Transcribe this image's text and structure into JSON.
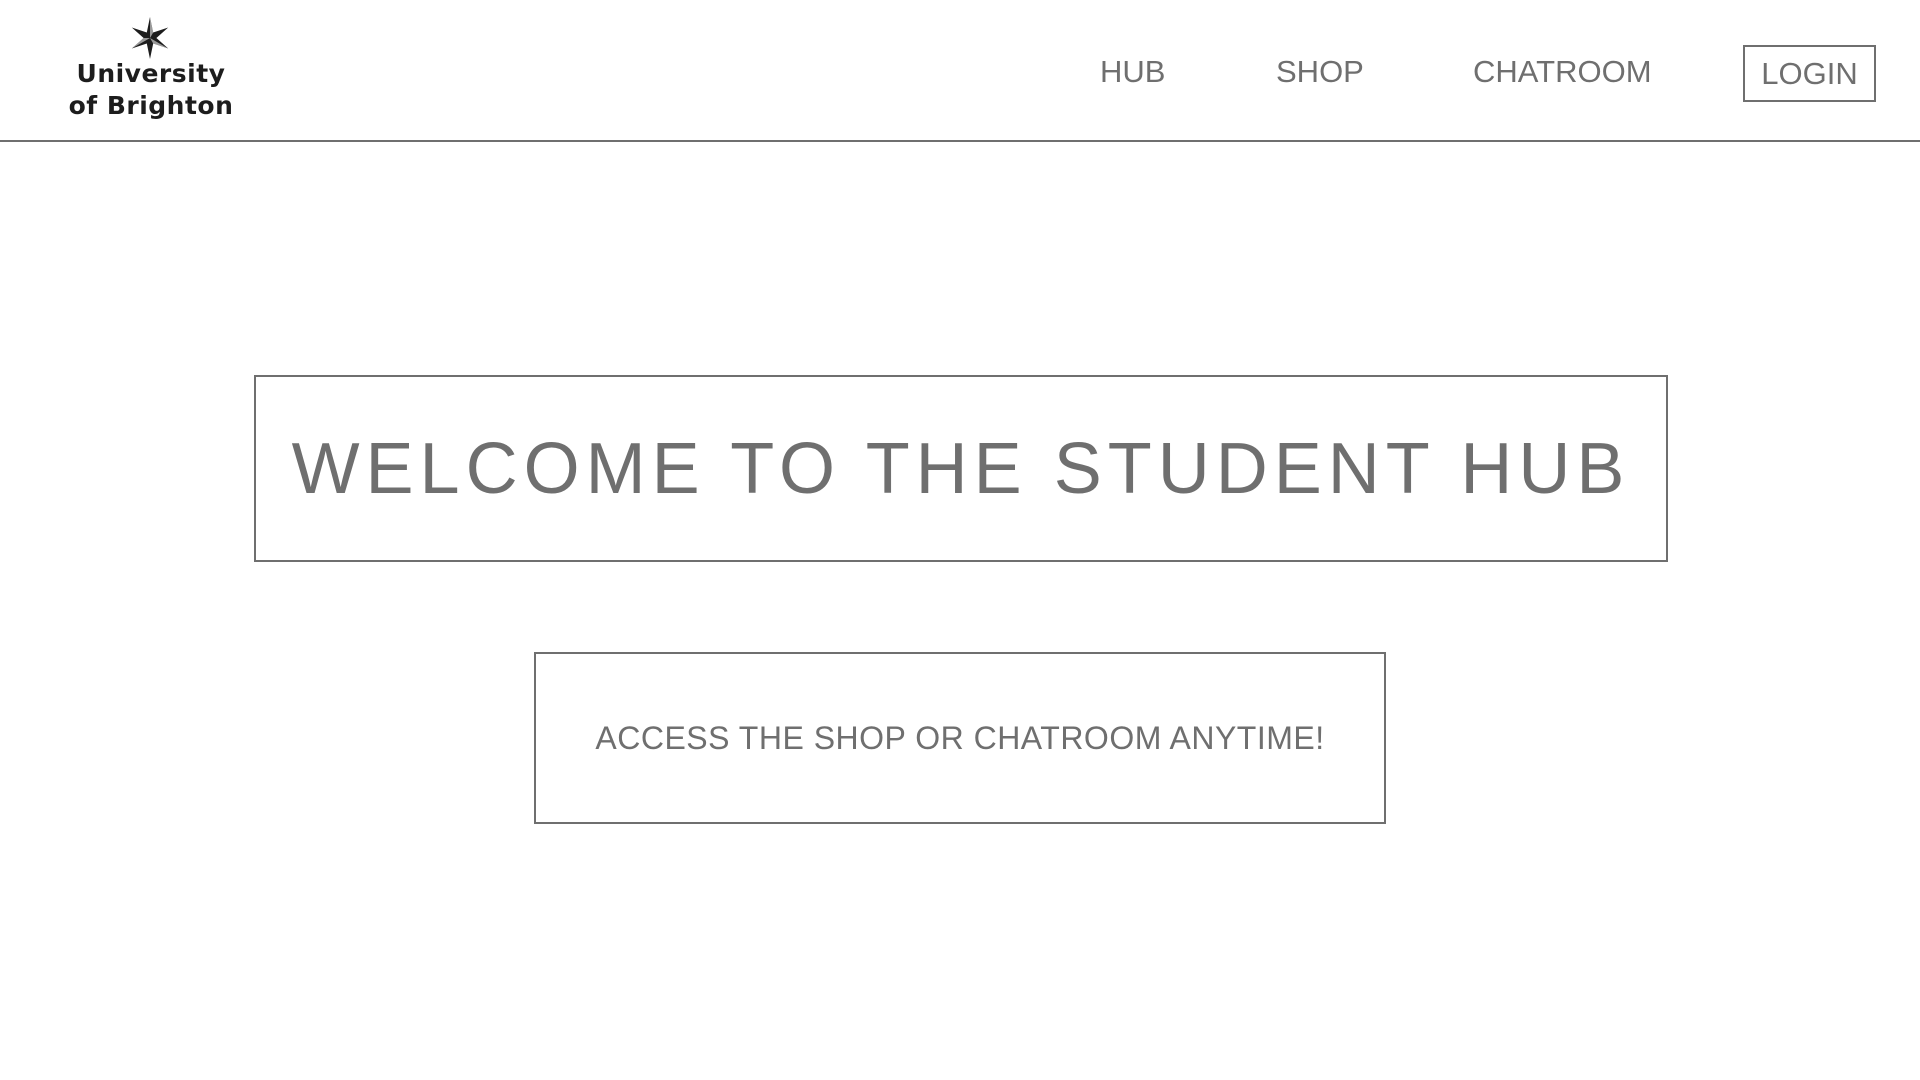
{
  "header": {
    "logo": {
      "icon": "star-icon",
      "line1": "University",
      "line2": "of Brighton",
      "color": "#1d1d1d"
    },
    "nav": {
      "hub": "HUB",
      "shop": "SHOP",
      "chatroom": "CHATROOM",
      "login": "LOGIN"
    }
  },
  "main": {
    "welcome_title": "WELCOME TO THE STUDENT HUB",
    "access_message": "ACCESS THE SHOP OR CHATROOM ANYTIME!"
  },
  "colors": {
    "text": "#6f6f6f",
    "border": "#6f6f6f",
    "background": "#ffffff"
  }
}
